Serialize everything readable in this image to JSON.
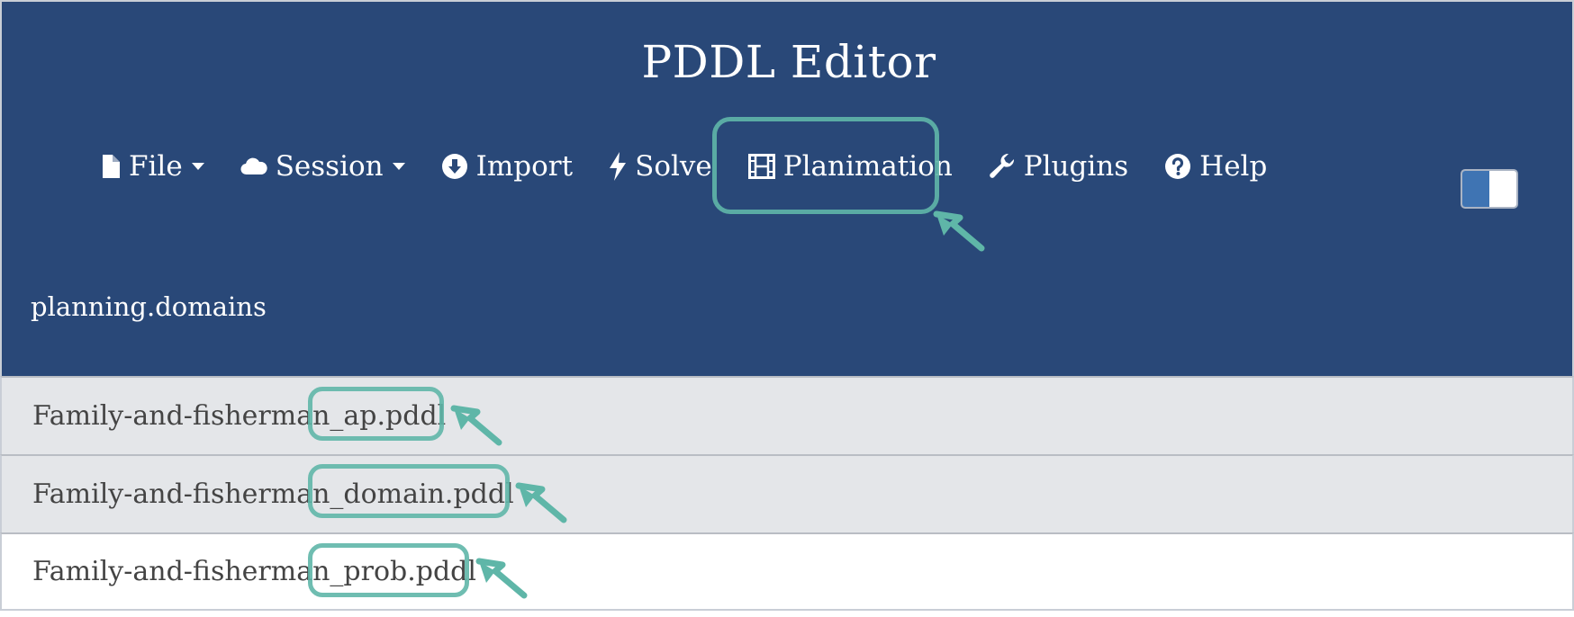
{
  "app": {
    "title": "PDDL Editor",
    "brand": "planning.domains"
  },
  "menu": [
    {
      "label": "File",
      "icon": "file-icon",
      "dropdown": true
    },
    {
      "label": "Session",
      "icon": "cloud-icon",
      "dropdown": true
    },
    {
      "label": "Import",
      "icon": "download-circle-icon",
      "dropdown": false
    },
    {
      "label": "Solve",
      "icon": "bolt-icon",
      "dropdown": false
    },
    {
      "label": "Planimation",
      "icon": "film-icon",
      "dropdown": false
    },
    {
      "label": "Plugins",
      "icon": "wrench-icon",
      "dropdown": false
    },
    {
      "label": "Help",
      "icon": "question-circle-icon",
      "dropdown": false
    }
  ],
  "toggle": {
    "state": "on"
  },
  "files": [
    {
      "name": "Family-and-fisherman_ap.pddl"
    },
    {
      "name": "Family-and-fisherman_domain.pddl"
    },
    {
      "name": "Family-and-fisherman_prob.pddl"
    }
  ],
  "colors": {
    "header_bg": "#294878",
    "highlight": "#5fb6a8",
    "toggle_on": "#3f74b3",
    "row_shaded": "#e4e6e9"
  }
}
